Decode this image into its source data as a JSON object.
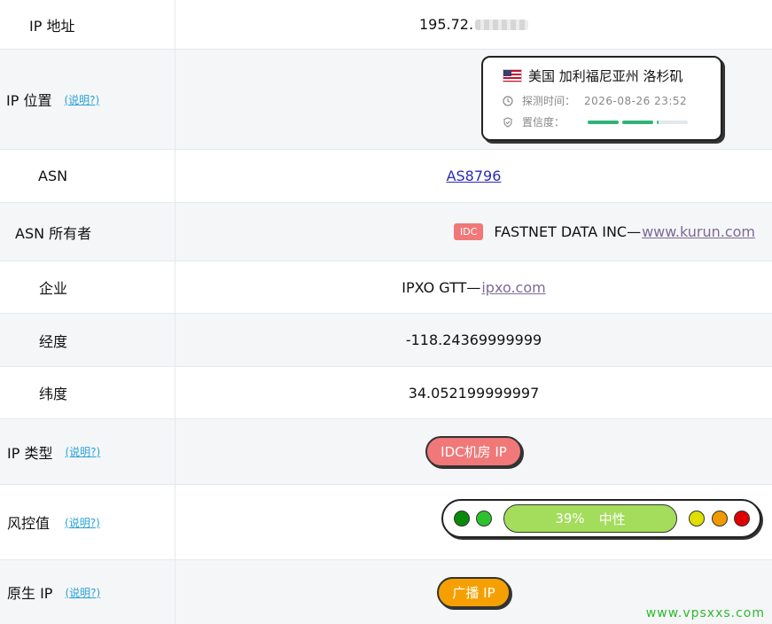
{
  "rows": {
    "ip": {
      "label": "IP 地址",
      "value_prefix": "195.72."
    },
    "location": {
      "label": "IP 位置",
      "help": "(说明?)",
      "card": {
        "title": "美国 加利福尼亚州 洛杉矶",
        "time_label": "探测时间：",
        "time_value": "2026-08-26 23:52",
        "confidence_label": "置信度：",
        "confidence_level": 0.7
      }
    },
    "asn": {
      "label": "ASN",
      "value": "AS8796"
    },
    "asn_owner": {
      "label": "ASN 所有者",
      "tag": "IDC",
      "name": "FASTNET DATA INC—",
      "link": "www.kurun.com"
    },
    "company": {
      "label": "企业",
      "name": "IPXO GTT—",
      "link": "ipxo.com"
    },
    "longitude": {
      "label": "经度",
      "value": "-118.24369999999"
    },
    "latitude": {
      "label": "纬度",
      "value": "34.052199999997"
    },
    "ip_type": {
      "label": "IP 类型",
      "help": "(说明?)",
      "value": "IDC机房 IP"
    },
    "risk": {
      "label": "风控值",
      "help": "(说明?)",
      "percent": "39%",
      "text": "中性",
      "value": 0.39,
      "colors": {
        "dot1": "#0a8a0a",
        "dot2": "#2ec12e",
        "bar": "#a3dd5b",
        "dot3": "#e0e000",
        "dot4": "#f09a00",
        "dot5": "#e00000"
      }
    },
    "native_ip": {
      "label": "原生 IP",
      "help": "(说明?)",
      "value": "广播 IP"
    }
  },
  "watermark": "www.vpsxxs.com",
  "colors": {
    "accent_help": "#29a3d6",
    "row_alt": "#f5f6f8",
    "confidence_fill": "#2fb378"
  }
}
